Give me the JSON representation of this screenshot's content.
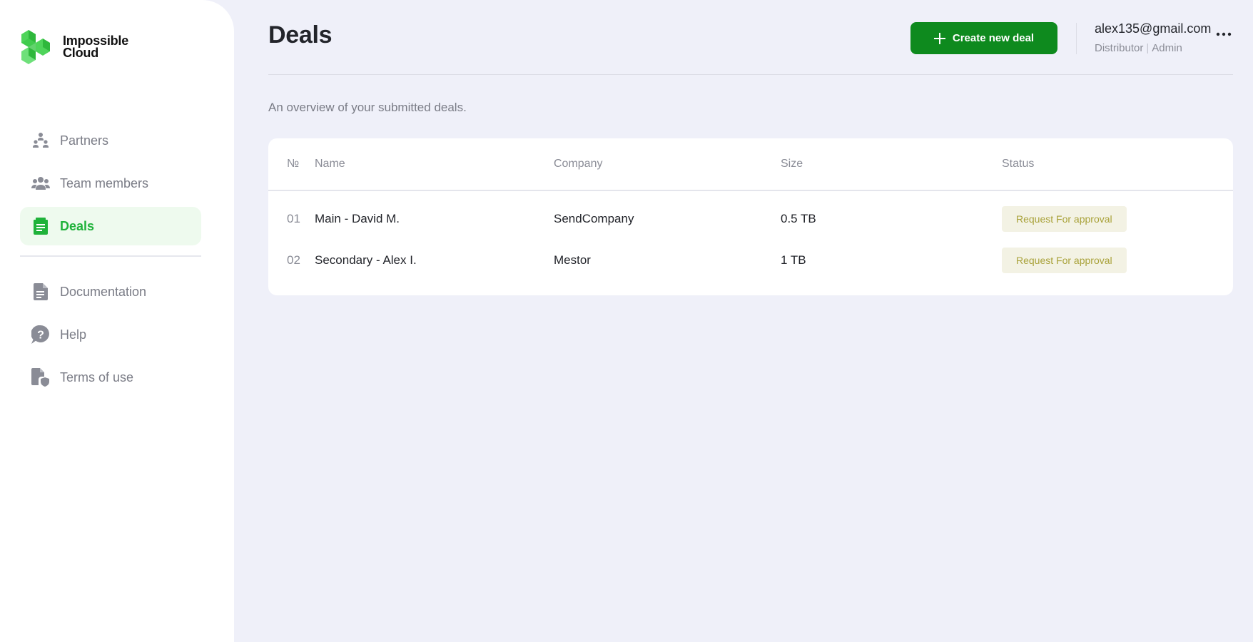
{
  "brand": {
    "line1": "Impossible",
    "line2": "Cloud"
  },
  "sidebar": {
    "items": [
      {
        "label": "Partners",
        "icon": "partners-icon"
      },
      {
        "label": "Team members",
        "icon": "team-icon"
      },
      {
        "label": "Deals",
        "icon": "deals-icon",
        "active": true
      }
    ],
    "secondary": [
      {
        "label": "Documentation",
        "icon": "document-icon"
      },
      {
        "label": "Help",
        "icon": "help-icon"
      },
      {
        "label": "Terms of use",
        "icon": "terms-icon"
      }
    ]
  },
  "header": {
    "title": "Deals",
    "create_label": "Create new deal",
    "user": {
      "email": "alex135@gmail.com",
      "role1": "Distributor",
      "separator": "|",
      "role2": "Admin"
    }
  },
  "main": {
    "subtitle": "An overview of your submitted deals."
  },
  "table": {
    "headers": {
      "no": "№",
      "name": "Name",
      "company": "Company",
      "size": "Size",
      "status": "Status"
    },
    "rows": [
      {
        "no": "01",
        "name": "Main - David M.",
        "company": "SendCompany",
        "size": "0.5 TB",
        "status": "Request For approval"
      },
      {
        "no": "02",
        "name": "Secondary - Alex I.",
        "company": "Mestor",
        "size": "1 TB",
        "status": "Request For approval"
      }
    ]
  },
  "colors": {
    "accent": "#0e8a1e",
    "active": "#1fb23a",
    "badge_bg": "#f3f2e4",
    "badge_text": "#a9a23a",
    "page_bg": "#eff0f9"
  }
}
